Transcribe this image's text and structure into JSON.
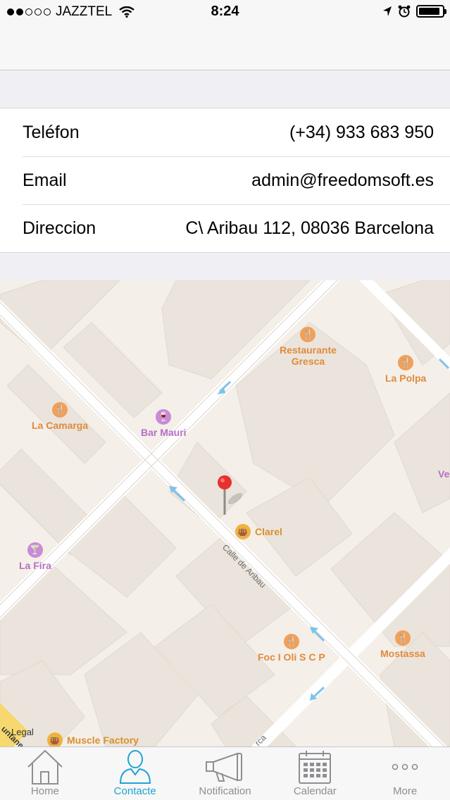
{
  "status_bar": {
    "carrier": "JAZZTEL",
    "time": "8:24",
    "signal_dots_full": 2,
    "signal_dots_total": 5,
    "battery_level_percent": 90
  },
  "contact": {
    "rows": [
      {
        "label": "Teléfon",
        "value": "(+34) 933 683 950"
      },
      {
        "label": "Email",
        "value": "admin@freedomsoft.es"
      },
      {
        "label": "Direccion",
        "value": "C\\ Aribau 112, 08036 Barcelona"
      }
    ]
  },
  "map": {
    "pois": {
      "restaurante_gresca": "Restaurante\nGresca",
      "la_polpa": "La Polpa",
      "la_camarga": "La Camarga",
      "bar_mauri": "Bar Mauri",
      "ve": "Ve",
      "clarel": "Clarel",
      "la_fira": "La Fira",
      "foc_i_oli": "Foc I Oli S C P",
      "mostassa": "Mostassa",
      "muscle_factory": "Muscle Factory"
    },
    "streets": {
      "aribau": "Calle de Aribau",
      "bottom": "rca",
      "corner": "untaner"
    },
    "legal": "Legal"
  },
  "tabs": [
    {
      "label": "Home",
      "icon": "home-icon",
      "active": false
    },
    {
      "label": "Contacte",
      "icon": "contact-person-icon",
      "active": true
    },
    {
      "label": "Notification",
      "icon": "megaphone-icon",
      "active": false
    },
    {
      "label": "Calendar",
      "icon": "calendar-icon",
      "active": false
    },
    {
      "label": "More",
      "icon": "more-dots-icon",
      "active": false
    }
  ],
  "colors": {
    "accent": "#1ea3d5",
    "food_poi": "#e08a3c",
    "bar_poi": "#b56fc4",
    "pin": "#e8302c"
  }
}
